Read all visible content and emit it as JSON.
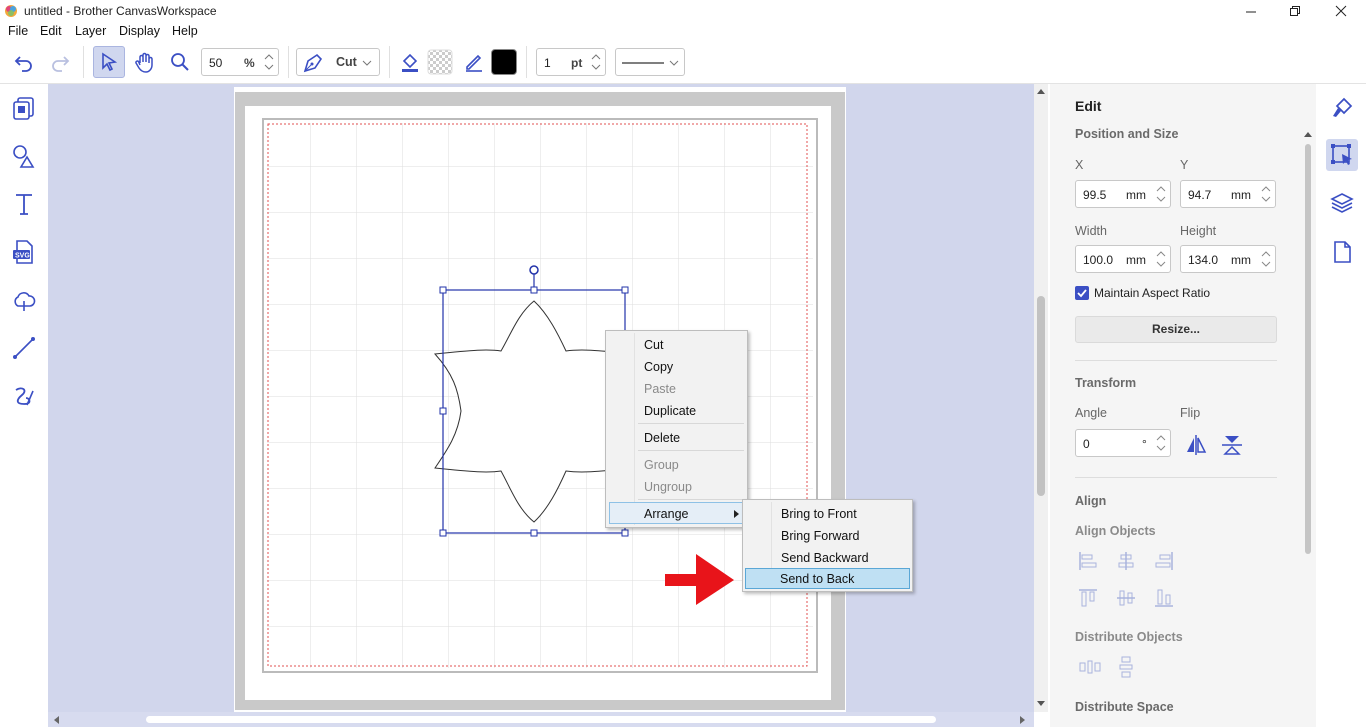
{
  "window": {
    "title": "untitled - Brother CanvasWorkspace"
  },
  "menu": [
    "File",
    "Edit",
    "Layer",
    "Display",
    "Help"
  ],
  "toolbar": {
    "zoom_value": "50",
    "zoom_unit": "%",
    "mode_label": "Cut",
    "line_width_value": "1",
    "line_width_unit": "pt",
    "colors": {
      "line_color": "#000000"
    }
  },
  "context_menu": {
    "items": [
      "Cut",
      "Copy",
      "Paste",
      "Duplicate",
      "Delete",
      "Group",
      "Ungroup",
      "Arrange"
    ],
    "disabled": [
      "Paste",
      "Group",
      "Ungroup"
    ]
  },
  "submenu": {
    "items": [
      "Bring to Front",
      "Bring Forward",
      "Send Backward",
      "Send to Back"
    ],
    "highlighted": "Send to Back"
  },
  "panel": {
    "title": "Edit",
    "position_size": "Position and Size",
    "x_label": "X",
    "x_value": "99.5",
    "x_unit": "mm",
    "y_label": "Y",
    "y_value": "94.7",
    "y_unit": "mm",
    "width_label": "Width",
    "width_value": "100.0",
    "width_unit": "mm",
    "height_label": "Height",
    "height_value": "134.0",
    "height_unit": "mm",
    "maintain_aspect": "Maintain Aspect Ratio",
    "resize_button": "Resize...",
    "transform": "Transform",
    "angle_label": "Angle",
    "angle_value": "0",
    "angle_unit": "°",
    "flip_label": "Flip",
    "align": "Align",
    "align_objects": "Align Objects",
    "distribute_objects": "Distribute Objects",
    "distribute_space": "Distribute Space"
  },
  "colors": {
    "accent": "#3b4fc4",
    "canvas_bg": "#d1d6ec",
    "highlight": "#bfe0f3",
    "arrow": "#e8141a"
  }
}
